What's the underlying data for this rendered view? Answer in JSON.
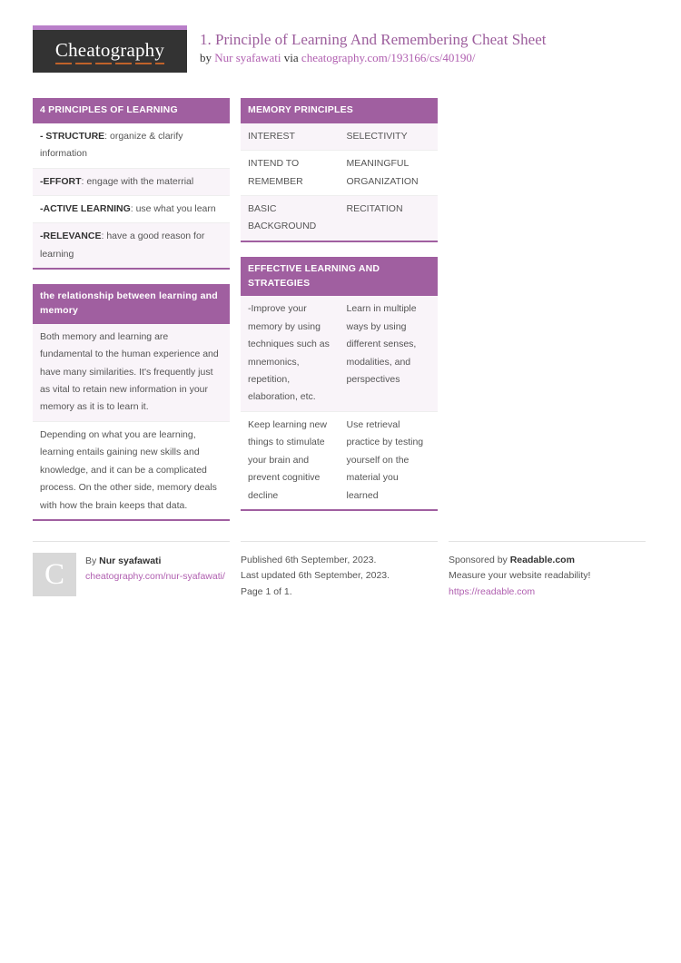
{
  "header": {
    "logo_text": "Cheatography",
    "title": "1. Principle of Learning And Remembering Cheat Sheet",
    "by_prefix": "by ",
    "author": "Nur syafawati",
    "via": " via ",
    "source_url": "cheatography.com/193166/cs/40190/"
  },
  "left_column": {
    "blocks": [
      {
        "title": "4 PRINCIPLES OF LEARNING",
        "rows": [
          {
            "bold": "- STRUCTURE",
            "text": ": organize & clarify information"
          },
          {
            "bold": "-EFFORT",
            "text": ": engage with the materrial"
          },
          {
            "bold": "-ACTIVE LEARNING",
            "text": ": use what you learn"
          },
          {
            "bold": "-RELEVANCE",
            "text": ": have a good reason for learning"
          }
        ]
      },
      {
        "title": "the relationship between learning and memory",
        "rows": [
          {
            "bold": "",
            "text": "Both memory and learning are fundamental to the human experience and have many similarities. It's frequently just as vital to retain new information in your memory as it is to learn it."
          },
          {
            "bold": "",
            "text": "Depending on what you are learning, learning entails gaining new skills and knowledge, and it can be a complicated process. On the other side, memory deals with how the brain keeps that data."
          }
        ]
      }
    ]
  },
  "right_column": {
    "blocks": [
      {
        "title": "MEMORY PRINCIPLES",
        "rows": [
          {
            "left": "INTEREST",
            "right": "SELECTIVITY"
          },
          {
            "left": "INTEND TO REMEMBER",
            "right": "MEANINGFUL ORGANIZATION"
          },
          {
            "left": "BASIC BACKGROUND",
            "right": "RECITATION"
          }
        ]
      },
      {
        "title": "EFFECTIVE LEARNING AND STRATEGIES",
        "rows": [
          {
            "left": "-Improve your memory by using techniques such as mnemonics, repetition, elaboration, etc.",
            "right": "Learn in multiple ways by using different senses, modalities, and perspectives"
          },
          {
            "left": "Keep learning new things to stimulate your brain and prevent cognitive decline",
            "right": "Use retrieval practice by testing yourself on the material you learned"
          }
        ]
      }
    ]
  },
  "footer": {
    "avatar_letter": "C",
    "by_label": "By ",
    "author_name": "Nur syafawati",
    "author_url": "cheatography.com/nur-syafawati/",
    "published": "Published 6th September, 2023.",
    "updated": "Last updated 6th September, 2023.",
    "pages": "Page 1 of 1.",
    "sponsor_prefix": "Sponsored by ",
    "sponsor_name": "Readable.com",
    "sponsor_tagline": "Measure your website readability!",
    "sponsor_url": "https://readable.com"
  }
}
